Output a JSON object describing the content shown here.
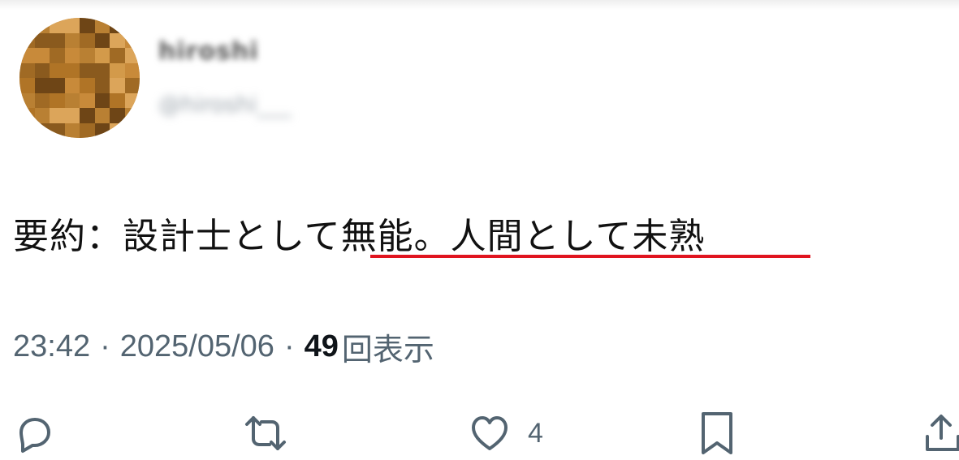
{
  "author": {
    "display_name": "hiroshi",
    "handle": "@hiroshi___"
  },
  "tweet": {
    "text_before": "要約：設計士として",
    "text_highlighted": "無能。人間として未熟",
    "highlight_color": "#e0141f"
  },
  "meta": {
    "time": "23:42",
    "date": "2025/05/06",
    "separator": "·",
    "views_count": "49",
    "views_label": "回表示"
  },
  "actions": {
    "reply_icon": "speech-bubble-icon",
    "retweet_icon": "repost-arrows-icon",
    "like_icon": "heart-icon",
    "like_count": "4",
    "bookmark_icon": "bookmark-icon",
    "share_icon": "upload-share-icon"
  },
  "colors": {
    "text": "#0f1419",
    "secondary": "#536471",
    "avatar_base": "#b47a2c"
  }
}
